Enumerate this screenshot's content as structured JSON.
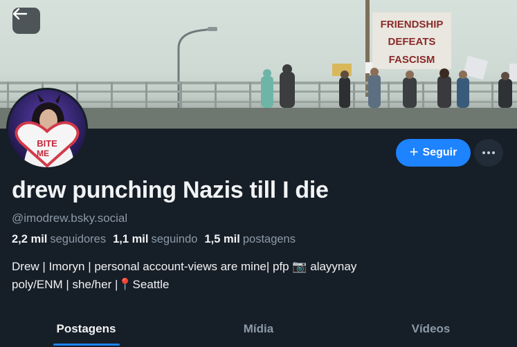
{
  "header": {
    "back_icon": "arrow-left-icon",
    "banner_sign": [
      "FRIENDSHIP",
      "DEFEATS",
      "FASCISM"
    ],
    "avatar_text": [
      "BITE",
      "ME"
    ]
  },
  "actions": {
    "follow_label": "Seguir",
    "more_icon": "ellipsis-icon"
  },
  "profile": {
    "display_name": "drew punching Nazis till I die",
    "handle": "@imodrew.bsky.social",
    "stats": {
      "followers_count": "2,2 mil",
      "followers_label": "seguidores",
      "following_count": "1,1 mil",
      "following_label": "seguindo",
      "posts_count": "1,5 mil",
      "posts_label": "postagens"
    },
    "bio_lines": [
      "Drew | Imoryn | personal account-views are mine| pfp 📷 alayynay",
      "poly/ENM | she/her |📍Seattle"
    ]
  },
  "tabs": [
    {
      "label": "Postagens",
      "active": true
    },
    {
      "label": "Mídia",
      "active": false
    },
    {
      "label": "Vídeos",
      "active": false
    }
  ],
  "colors": {
    "background": "#161e27",
    "accent": "#1d83ff",
    "muted_text": "#8c9aa8"
  }
}
